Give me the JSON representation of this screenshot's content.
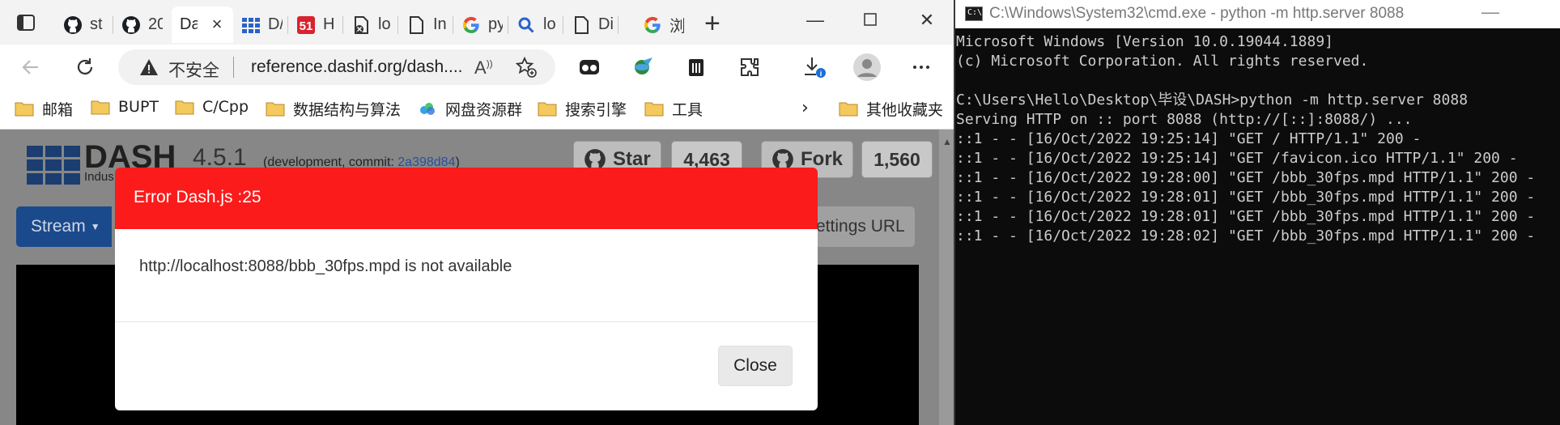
{
  "browser": {
    "tabs": [
      {
        "label": "st",
        "icon": "github-icon"
      },
      {
        "label": "20",
        "icon": "github-icon"
      },
      {
        "label": "Da",
        "icon": "dash-icon",
        "active": true
      },
      {
        "label": "D/",
        "icon": "grid-icon"
      },
      {
        "label": "H",
        "icon": "51-icon"
      },
      {
        "label": "lo",
        "icon": "blocked-page-icon"
      },
      {
        "label": "In",
        "icon": "page-icon"
      },
      {
        "label": "py",
        "icon": "google-icon"
      },
      {
        "label": "lo",
        "icon": "search-icon"
      },
      {
        "label": "Di",
        "icon": "page-icon"
      },
      {
        "label": "浏",
        "icon": "google-icon"
      }
    ],
    "address_bar": {
      "security_label": "不安全",
      "url": "reference.dashif.org/dash...."
    },
    "bookmarks": [
      {
        "label": "邮箱",
        "icon": "folder-icon"
      },
      {
        "label": "BUPT",
        "icon": "folder-icon"
      },
      {
        "label": "C/Cpp",
        "icon": "folder-icon"
      },
      {
        "label": "数据结构与算法",
        "icon": "folder-icon"
      },
      {
        "label": "网盘资源群",
        "icon": "cloud-icon"
      },
      {
        "label": "搜索引擎",
        "icon": "folder-icon"
      },
      {
        "label": "工具",
        "icon": "folder-icon"
      },
      {
        "label": "其他收藏夹",
        "icon": "folder-icon"
      }
    ]
  },
  "page": {
    "title": "DASH",
    "version": "4.5.1",
    "dev_prefix": "(development, commit: ",
    "commit": "2a398d84",
    "dev_suffix": ")",
    "subtitle": "Indus",
    "star_label": "Star",
    "star_count": "4,463",
    "fork_label": "Fork",
    "fork_count": "1,560",
    "stream_label": "Stream",
    "settings_url_label": "ettings URL"
  },
  "modal": {
    "title": "Error Dash.js :25",
    "message": "http://localhost:8088/bbb_30fps.mpd is not available",
    "close_label": "Close"
  },
  "cmd": {
    "title": "C:\\Windows\\System32\\cmd.exe - python  -m http.server 8088",
    "lines": [
      "Microsoft Windows [Version 10.0.19044.1889]",
      "(c) Microsoft Corporation. All rights reserved.",
      "",
      "C:\\Users\\Hello\\Desktop\\毕设\\DASH>python -m http.server 8088",
      "Serving HTTP on :: port 8088 (http://[::]:8088/) ...",
      "::1 - - [16/Oct/2022 19:25:14] \"GET / HTTP/1.1\" 200 -",
      "::1 - - [16/Oct/2022 19:25:14] \"GET /favicon.ico HTTP/1.1\" 200 -",
      "::1 - - [16/Oct/2022 19:28:00] \"GET /bbb_30fps.mpd HTTP/1.1\" 200 -",
      "::1 - - [16/Oct/2022 19:28:01] \"GET /bbb_30fps.mpd HTTP/1.1\" 200 -",
      "::1 - - [16/Oct/2022 19:28:01] \"GET /bbb_30fps.mpd HTTP/1.1\" 200 -",
      "::1 - - [16/Oct/2022 19:28:02] \"GET /bbb_30fps.mpd HTTP/1.1\" 200 -"
    ]
  },
  "colors": {
    "modal_header": "#fb1b1b",
    "cmd_background": "#0c0c0c",
    "stream_button": "#1a4a8c"
  }
}
